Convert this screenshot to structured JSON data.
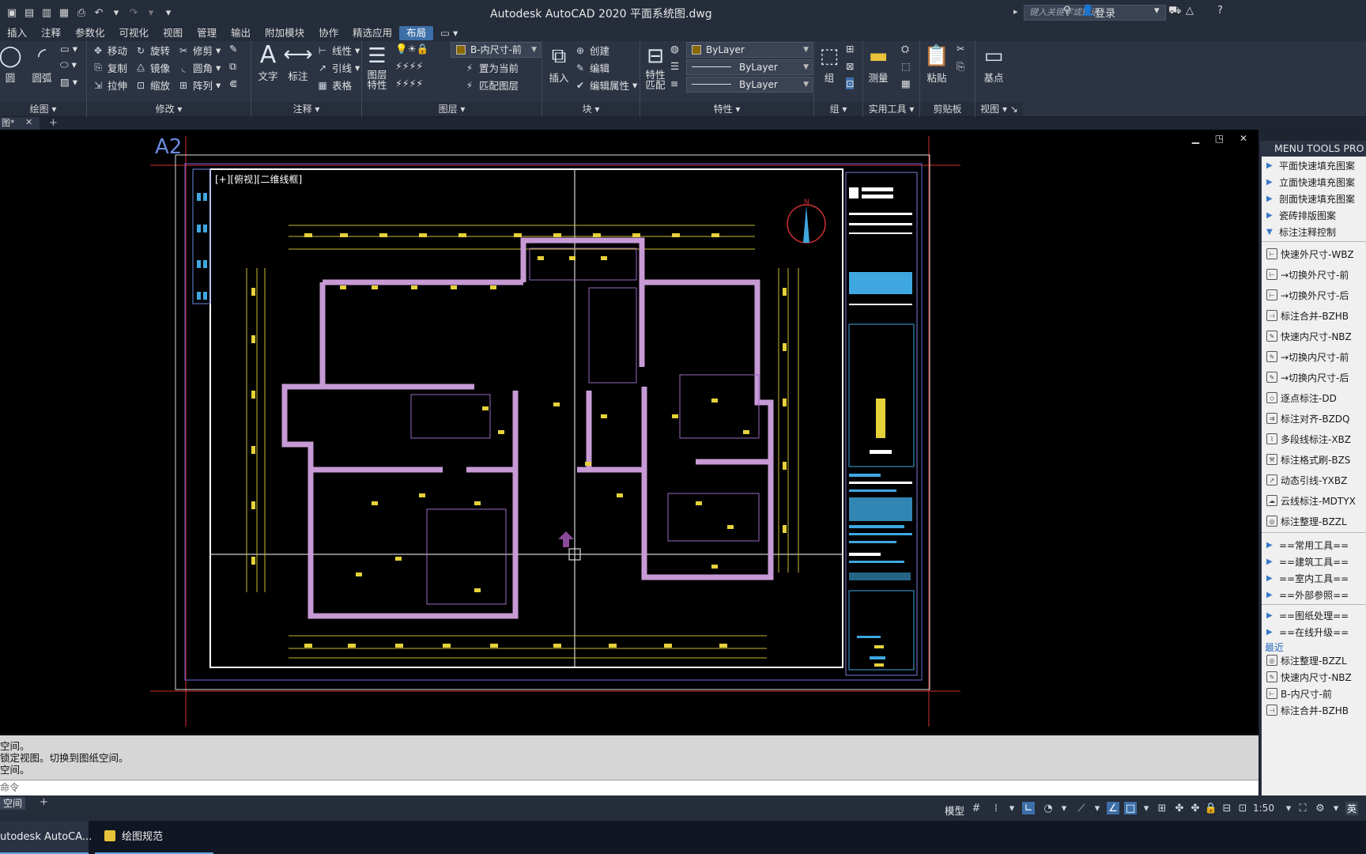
{
  "app": {
    "title": "Autodesk AutoCAD 2020    平面系统图.dwg",
    "search_placeholder": "键入关键字或短语",
    "login": "登录"
  },
  "ribbon_tabs": [
    "插入",
    "注释",
    "参数化",
    "可视化",
    "视图",
    "管理",
    "输出",
    "附加模块",
    "协作",
    "精选应用",
    "布局"
  ],
  "active_tab": "布局",
  "ribbon": {
    "draw": {
      "title": "绘图",
      "circle": "圆",
      "arc": "圆弧"
    },
    "modify": {
      "title": "修改",
      "move": "移动",
      "rotate": "旋转",
      "trim": "修剪",
      "copy": "复制",
      "mirror": "镜像",
      "fillet": "圆角",
      "stretch": "拉伸",
      "scale": "缩放",
      "array": "阵列"
    },
    "annotation": {
      "title": "注释",
      "text": "文字",
      "dimension": "标注",
      "linear": "线性",
      "leader": "引线",
      "table": "表格"
    },
    "layers": {
      "title": "图层",
      "layer_props": "图层\n特性",
      "current_layer": "B-内尺寸-前",
      "set_current": "置为当前",
      "match_layer": "匹配图层"
    },
    "block": {
      "title": "块",
      "insert": "插入",
      "create": "创建",
      "edit": "编辑",
      "edit_attr": "编辑属性"
    },
    "properties": {
      "title": "特性",
      "match": "特性\n匹配",
      "color": "ByLayer",
      "linetype": "ByLayer",
      "lineweight": "ByLayer"
    },
    "groups": {
      "title": "组",
      "group": "组"
    },
    "utilities": {
      "title": "实用工具",
      "measure": "测量"
    },
    "clipboard": {
      "title": "剪贴板",
      "paste": "粘贴"
    },
    "view": {
      "title": "视图",
      "base": "基点"
    }
  },
  "doc_tab": {
    "label": "图*"
  },
  "viewport": {
    "label": "[+][俯视][二维线框]",
    "sheet": "A2",
    "north": "N"
  },
  "palette": {
    "header": "MENU TOOLS PRO",
    "top_items": [
      "平面快速填充图案",
      "立面快速填充图案",
      "剖面快速填充图案",
      "瓷砖排版图案",
      "标注注释控制"
    ],
    "tool_items": [
      "快速外尺寸-WBZ",
      "→切换外尺寸-前",
      "→切换外尺寸-后",
      "标注合并-BZHB",
      "快速内尺寸-NBZ",
      "→切换内尺寸-前",
      "→切换内尺寸-后",
      "逐点标注-DD",
      "标注对齐-BZDQ",
      "多段线标注-XBZ",
      "标注格式刷-BZS",
      "动态引线-YXBZ",
      "云线标注-MDTYX",
      "标注整理-BZZL"
    ],
    "group_items": [
      "==常用工具==",
      "==建筑工具==",
      "==室内工具==",
      "==外部参照=="
    ],
    "group_items2": [
      "==图纸处理==",
      "==在线升级=="
    ],
    "recent_label": "最近",
    "recent_items": [
      "标注整理-BZZL",
      "快速内尺寸-NBZ",
      "B-内尺寸-前",
      "标注合并-BZHB"
    ]
  },
  "command": {
    "history": [
      "空间。",
      "锁定视图。切换到图纸空间。",
      "空间。"
    ],
    "prompt": "命令"
  },
  "status": {
    "layout_tab": "空间",
    "model": "模型",
    "scale": "1:50",
    "ime": "英"
  },
  "taskbar": {
    "acad": "utodesk AutoCA...",
    "folder": "绘图规范"
  },
  "colors": {
    "accent": "#3d6fa8",
    "wall": "#c79ad6",
    "dim": "#e6d23a",
    "titleblock": "#3fa7e0"
  }
}
